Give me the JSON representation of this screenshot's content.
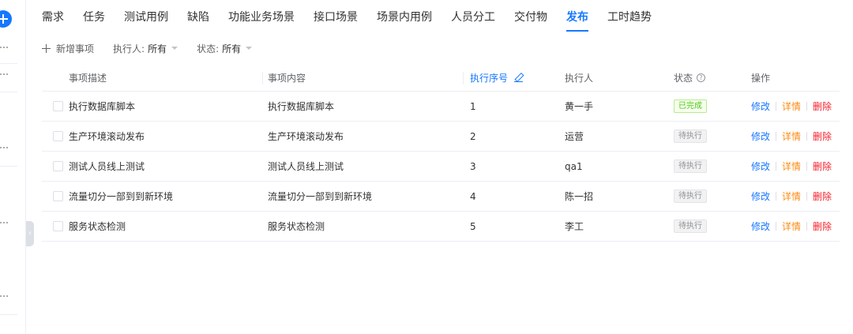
{
  "tabs": [
    {
      "label": "需求",
      "active": false
    },
    {
      "label": "任务",
      "active": false
    },
    {
      "label": "测试用例",
      "active": false
    },
    {
      "label": "缺陷",
      "active": false
    },
    {
      "label": "功能业务场景",
      "active": false
    },
    {
      "label": "接口场景",
      "active": false
    },
    {
      "label": "场景内用例",
      "active": false
    },
    {
      "label": "人员分工",
      "active": false
    },
    {
      "label": "交付物",
      "active": false
    },
    {
      "label": "发布",
      "active": true
    },
    {
      "label": "工时趋势",
      "active": false
    }
  ],
  "toolbar": {
    "add_label": "新增事项",
    "executor_label": "执行人:",
    "executor_value": "所有",
    "status_label": "状态:",
    "status_value": "所有"
  },
  "table": {
    "headers": {
      "desc": "事项描述",
      "content": "事项内容",
      "seq": "执行序号",
      "executor": "执行人",
      "status": "状态",
      "ops": "操作"
    },
    "rows": [
      {
        "desc": "执行数据库脚本",
        "content": "执行数据库脚本",
        "seq": "1",
        "executor": "黄一手",
        "status": "已完成",
        "status_type": "done"
      },
      {
        "desc": "生产环境滚动发布",
        "content": "生产环境滚动发布",
        "seq": "2",
        "executor": "运营",
        "status": "待执行",
        "status_type": "pending"
      },
      {
        "desc": "测试人员线上测试",
        "content": "测试人员线上测试",
        "seq": "3",
        "executor": "qa1",
        "status": "待执行",
        "status_type": "pending"
      },
      {
        "desc": "流量切分一部到到新环境",
        "content": "流量切分一部到到新环境",
        "seq": "4",
        "executor": "陈一招",
        "status": "待执行",
        "status_type": "pending"
      },
      {
        "desc": "服务状态检测",
        "content": "服务状态检测",
        "seq": "5",
        "executor": "李工",
        "status": "待执行",
        "status_type": "pending"
      }
    ],
    "actions": {
      "edit": "修改",
      "detail": "详情",
      "delete": "删除"
    }
  },
  "icons": {
    "rail_add": "plus-circle-icon",
    "rail_more": "ellipsis-icon",
    "add": "plus-icon",
    "dropdown": "caret-down-icon",
    "edit_header": "pencil-icon",
    "status_help": "question-circle-icon",
    "collapse": "chevron-left-icon"
  },
  "colors": {
    "accent": "#1677ff",
    "done": "#52c41a",
    "pending": "#909399",
    "detail": "#fa8c16",
    "delete": "#f5222d"
  }
}
